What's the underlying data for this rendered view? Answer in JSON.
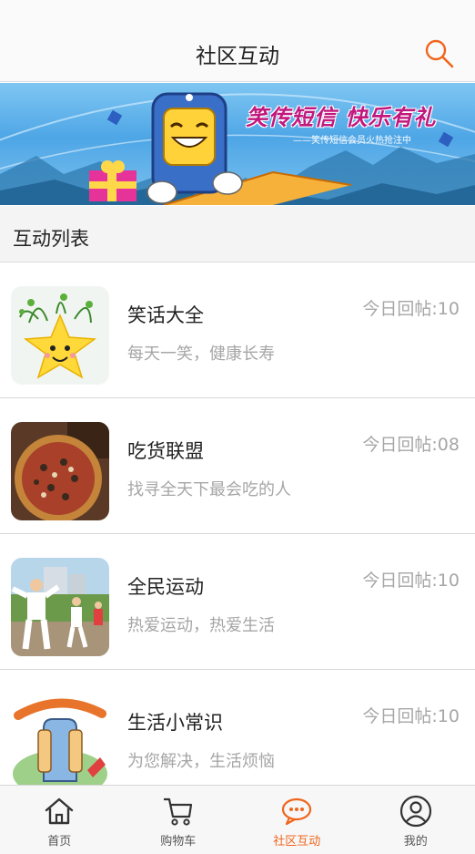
{
  "header": {
    "title": "社区互动",
    "search_icon": "search-icon"
  },
  "banner": {
    "headline": "笑传短信 快乐有礼",
    "sub": "——笑传短信会员火热抢注中"
  },
  "section": {
    "title": "互动列表"
  },
  "items": [
    {
      "name": "笑话大全",
      "desc": "每天一笑，健康长寿",
      "count": "今日回帖:10",
      "image": "star-plant-image"
    },
    {
      "name": "吃货联盟",
      "desc": "找寻全天下最会吃的人",
      "count": "今日回帖:08",
      "image": "pizza-image"
    },
    {
      "name": "全民运动",
      "desc": "热爱运动，热爱生活",
      "count": "今日回帖:10",
      "image": "exercise-image"
    },
    {
      "name": "生活小常识",
      "desc": "为您解决，生活烦恼",
      "count": "今日回帖:10",
      "image": "did-you-know-image"
    }
  ],
  "tabs": [
    {
      "label": "首页",
      "icon": "home-icon",
      "active": false
    },
    {
      "label": "购物车",
      "icon": "cart-icon",
      "active": false
    },
    {
      "label": "社区互动",
      "icon": "chat-bubble-icon",
      "active": true
    },
    {
      "label": "我的",
      "icon": "user-icon",
      "active": false
    }
  ],
  "colors": {
    "accent": "#f0651c",
    "muted_text": "#a6a6a6"
  }
}
